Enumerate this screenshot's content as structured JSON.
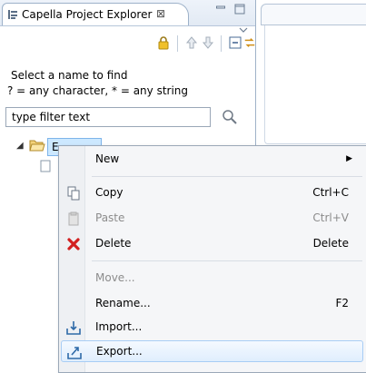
{
  "view": {
    "title": "Capella Project Explorer",
    "close_glyph": "⊠",
    "icons": [
      "project-explorer-icon",
      "close-icon",
      "minimize-icon",
      "maximize-icon"
    ]
  },
  "toolbar": {
    "icons": [
      "lock-icon",
      "navigate-up-icon",
      "navigate-down-icon",
      "collapse-all-icon",
      "link-with-editor-icon",
      "view-menu-icon"
    ]
  },
  "filter": {
    "legend": "Select a name to find",
    "hint": "? = any character, * = any string",
    "value": "type filter text"
  },
  "tree": {
    "items": [
      {
        "label": "E",
        "expanded": true
      }
    ]
  },
  "context_menu": {
    "items": [
      {
        "label": "New",
        "shortcut": "",
        "submenu": true,
        "enabled": true,
        "icon": ""
      },
      {
        "label": "Copy",
        "shortcut": "Ctrl+C",
        "enabled": true,
        "icon": "copy-icon"
      },
      {
        "label": "Paste",
        "shortcut": "Ctrl+V",
        "enabled": false,
        "icon": "paste-icon"
      },
      {
        "label": "Delete",
        "shortcut": "Delete",
        "enabled": true,
        "icon": "delete-icon"
      },
      {
        "label": "Move...",
        "shortcut": "",
        "enabled": false,
        "icon": ""
      },
      {
        "label": "Rename...",
        "shortcut": "F2",
        "enabled": true,
        "icon": ""
      },
      {
        "label": "Import...",
        "shortcut": "",
        "enabled": true,
        "icon": "import-icon"
      },
      {
        "label": "Export...",
        "shortcut": "",
        "enabled": true,
        "icon": "export-icon",
        "highlighted": true
      }
    ]
  },
  "colors": {
    "selection": "#cce8ff",
    "menu_background": "#f5f6f8",
    "highlight_border": "#a8cdf5",
    "delete_red": "#d22020",
    "lock_gold": "#e8b020"
  }
}
